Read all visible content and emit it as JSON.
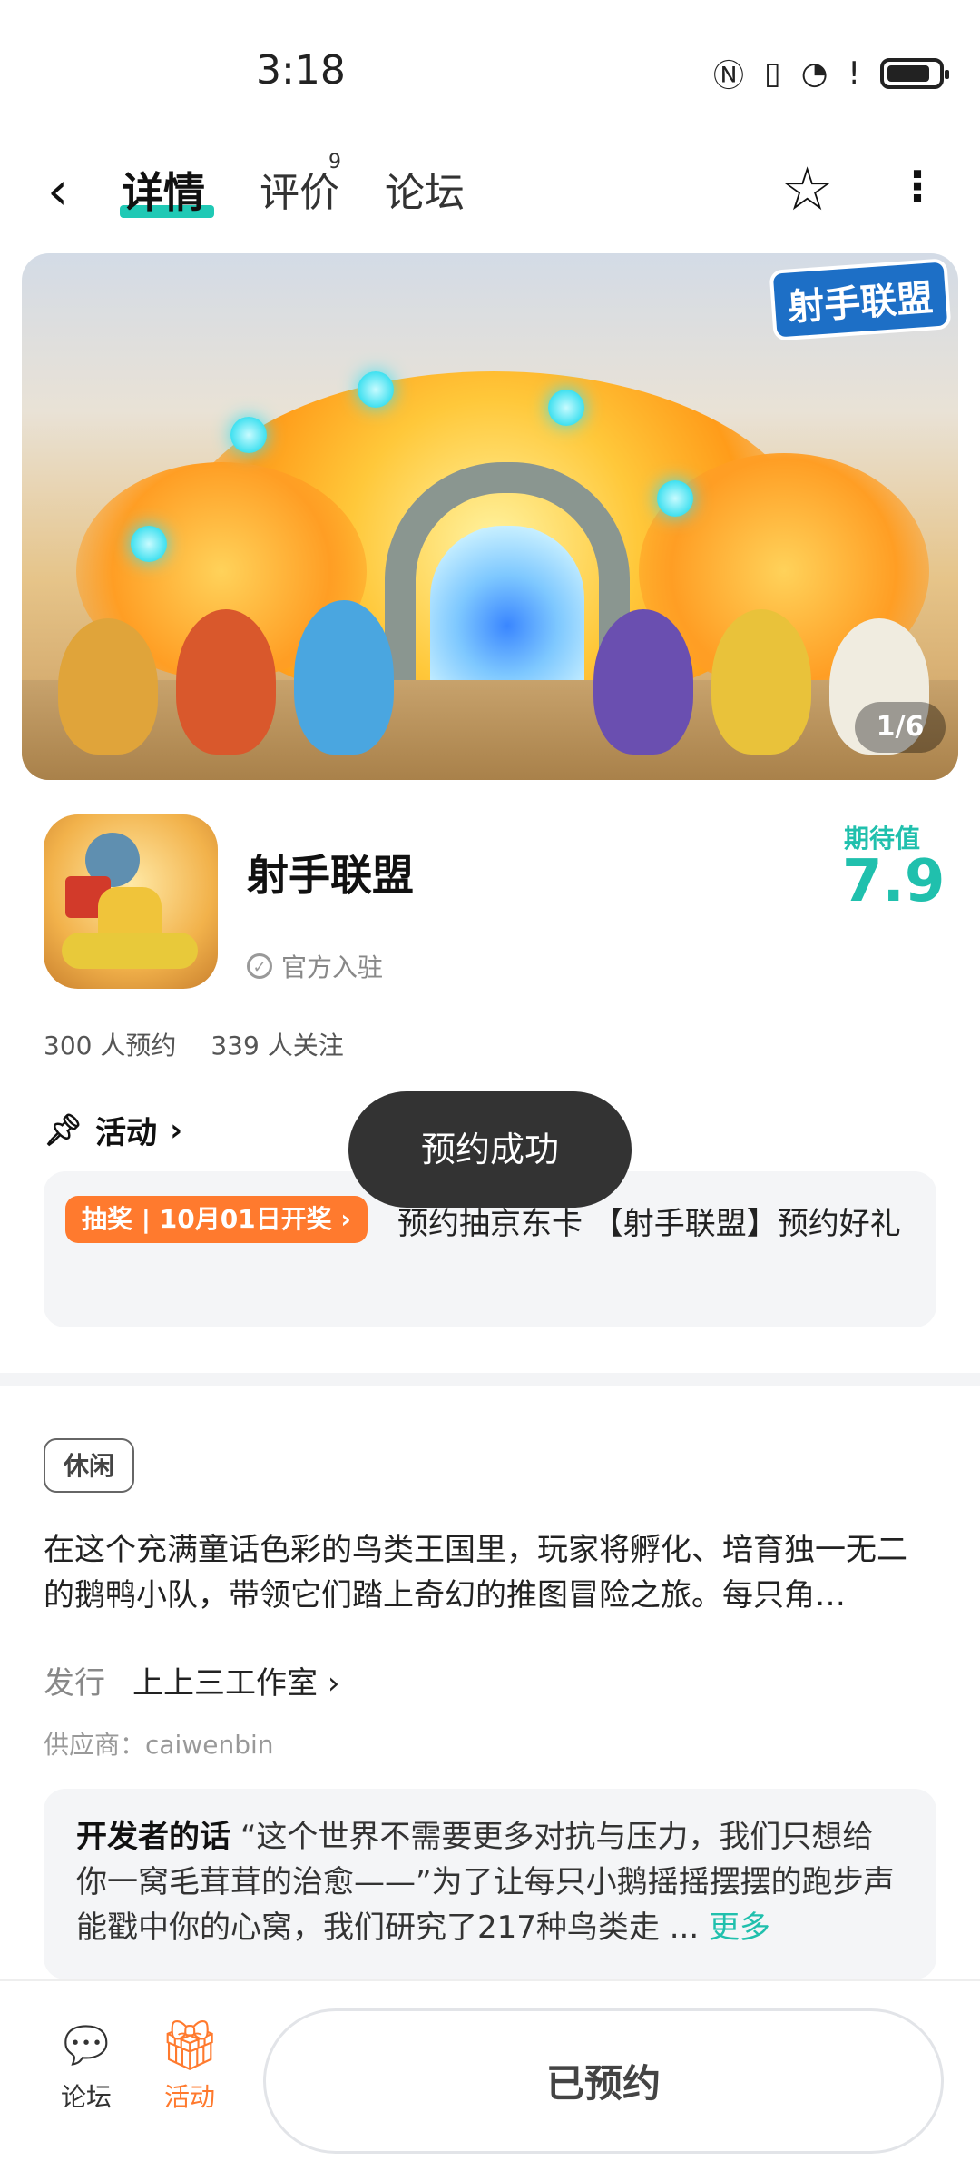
{
  "status_bar": {
    "time": "3:18"
  },
  "nav": {
    "back_icon": "chevron-left-icon",
    "tabs": [
      {
        "label": "详情",
        "badge": ""
      },
      {
        "label": "评价",
        "badge": "9"
      },
      {
        "label": "论坛",
        "badge": ""
      }
    ],
    "favorite_icon": "star-outline-icon",
    "more_icon": "more-vertical-icon"
  },
  "banner": {
    "logo_text": "射手联盟",
    "page_indicator": "1/6"
  },
  "app": {
    "name": "射手联盟",
    "official_label": "官方入驻",
    "expectation_label": "期待值",
    "expectation_value": "7.9",
    "reservations": "300 人预约",
    "followers": "339 人关注"
  },
  "activity": {
    "header": "活动",
    "tag": "抽奖 | 10月01日开奖",
    "text": "预约抽京东卡 【射手联盟】预约好礼"
  },
  "toast": "预约成功",
  "details": {
    "genre_tag": "休闲",
    "description": "在这个充满童话色彩的鸟类王国里，玩家将孵化、培育独一无二的鹅鸭小队，带领它们踏上奇幻的推图冒险之旅。每只角…",
    "publisher_label": "发行",
    "publisher_value": "上上三工作室",
    "supplier": "供应商：caiwenbin",
    "developer_title": "开发者的话",
    "developer_text": "“这个世界不需要更多对抗与压力，我们只想给你一窝毛茸茸的治愈——”为了让每只小鹅摇摇摆摆的跑步声能戳中你的心窝，我们研究了217种鸟类走 ...",
    "more_link": "更多"
  },
  "bottom_bar": {
    "forum_label": "论坛",
    "activity_label": "活动",
    "reserve_button": "已预约"
  },
  "colors": {
    "accent": "#20c0ad",
    "activity_orange": "#ff7a2e",
    "toast_bg": "#333333"
  }
}
